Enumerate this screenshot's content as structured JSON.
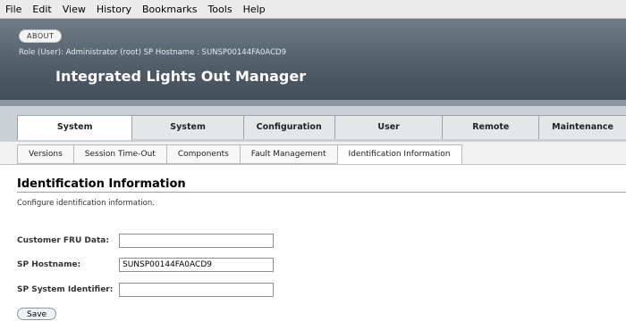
{
  "browser_menu": [
    "File",
    "Edit",
    "View",
    "History",
    "Bookmarks",
    "Tools",
    "Help"
  ],
  "header": {
    "about_label": "ABOUT",
    "role_line": "Role (User): Administrator (root)   SP Hostname : SUNSP00144FA0ACD9",
    "app_title": "Integrated Lights Out Manager"
  },
  "main_tabs": [
    {
      "label": "System Information",
      "active": true
    },
    {
      "label": "System Monitoring",
      "active": false
    },
    {
      "label": "Configuration",
      "active": false
    },
    {
      "label": "User Management",
      "active": false
    },
    {
      "label": "Remote Control",
      "active": false
    },
    {
      "label": "Maintenance",
      "active": false
    }
  ],
  "sub_tabs": [
    {
      "label": "Versions",
      "active": false
    },
    {
      "label": "Session Time-Out",
      "active": false
    },
    {
      "label": "Components",
      "active": false
    },
    {
      "label": "Fault Management",
      "active": false
    },
    {
      "label": "Identification Information",
      "active": true
    }
  ],
  "content": {
    "title": "Identification Information",
    "description": "Configure identification information.",
    "fields": [
      {
        "label": "Customer FRU Data:",
        "value": ""
      },
      {
        "label": "SP Hostname:",
        "value": "SUNSP00144FA0ACD9"
      },
      {
        "label": "SP System Identifier:",
        "value": ""
      }
    ],
    "save_label": "Save"
  }
}
